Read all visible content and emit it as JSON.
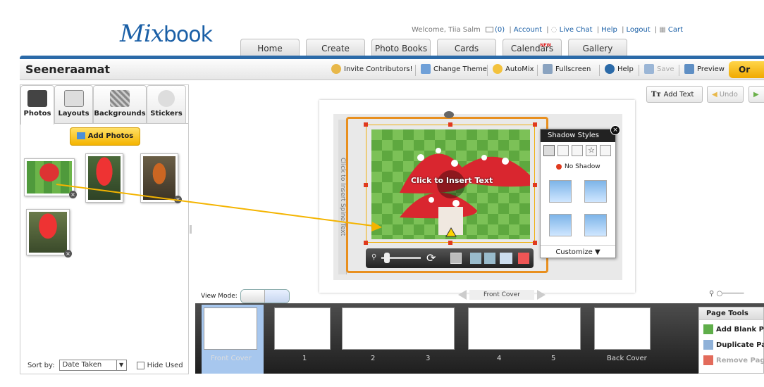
{
  "brand": {
    "logo_script": "Mix",
    "logo_rest": "book"
  },
  "top_links": {
    "welcome": "Welcome, Tiia Salm",
    "inbox": "(0)",
    "account": "Account",
    "live_chat": "Live Chat",
    "help": "Help",
    "logout": "Logout",
    "cart": "Cart"
  },
  "nav_tabs": [
    {
      "label": "Home"
    },
    {
      "label": "Create"
    },
    {
      "label": "Photo Books"
    },
    {
      "label": "Cards"
    },
    {
      "label": "Calendars",
      "badge": "NEW"
    },
    {
      "label": "Gallery"
    }
  ],
  "toolbar": {
    "project_title": "Seeneraamat",
    "invite": "Invite Contributors!",
    "change_theme": "Change Theme",
    "automix": "AutoMix",
    "fullscreen": "Fullscreen",
    "help": "Help",
    "save": "Save",
    "preview": "Preview",
    "order": "Or"
  },
  "left_panel": {
    "tabs": [
      {
        "label": "Photos"
      },
      {
        "label": "Layouts"
      },
      {
        "label": "Backgrounds"
      },
      {
        "label": "Stickers"
      }
    ],
    "add_photos": "Add Photos",
    "sort_label": "Sort by:",
    "sort_value": "Date Taken",
    "hide_used": "Hide Used"
  },
  "canvas": {
    "add_text": "Add Text",
    "undo": "Undo",
    "spine_text": "Click to Insert Spine Text",
    "insert_text": "Click to Insert Text",
    "view_mode": "View Mode:",
    "current_page": "Front Cover"
  },
  "shadow_panel": {
    "title": "Shadow Styles",
    "no_shadow": "No Shadow",
    "customize": "Customize ▼"
  },
  "filmstrip": {
    "labels": [
      "Front Cover",
      "1",
      "2",
      "3",
      "4",
      "5",
      "Back Cover"
    ]
  },
  "page_tools": {
    "title": "Page Tools",
    "add_blank": "Add Blank P",
    "duplicate": "Duplicate Pa",
    "remove": "Remove Pag"
  },
  "colors": {
    "brand_blue": "#2b6aa8",
    "accent_orange": "#e88f1e",
    "order_yellow": "#f0a900"
  }
}
